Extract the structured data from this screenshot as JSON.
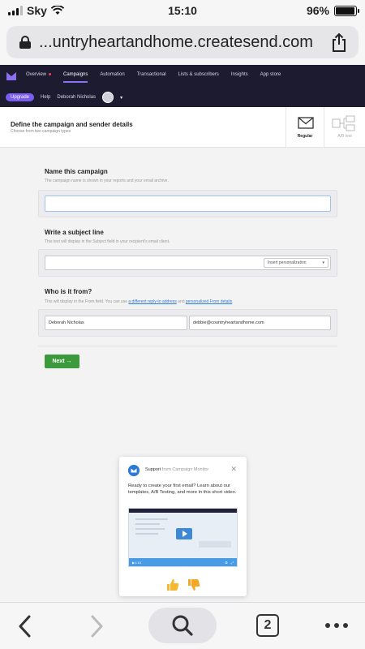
{
  "status_bar": {
    "carrier": "Sky",
    "time": "15:10",
    "battery": "96%",
    "battery_level": 0.96
  },
  "browser": {
    "url": "...untryheartandhome.createsend.com",
    "tab_count": "2"
  },
  "app_nav": {
    "items": [
      "Overview",
      "Campaigns",
      "Automation",
      "Transactional",
      "Lists & subscribers",
      "Insights",
      "App store"
    ],
    "active": "Campaigns",
    "upgrade_label": "Upgrade",
    "help_label": "Help",
    "user_name": "Deborah Nicholas"
  },
  "page": {
    "title": "Define the campaign and sender details",
    "subtitle": "Choose from two campaign types",
    "type_regular": "Regular",
    "type_ab": "A/B test"
  },
  "form": {
    "name_title": "Name this campaign",
    "name_help": "The campaign name is shown in your reports and your email archive.",
    "name_value": "",
    "subject_title": "Write a subject line",
    "subject_help": "This text will display in the Subject field in your recipient's email client.",
    "subject_value": "",
    "personalization_label": "Insert personalization",
    "from_title": "Who is it from?",
    "from_help_prefix": "This will display in the From field. You can use ",
    "from_help_link1": "a different reply-to address",
    "from_help_mid": " and ",
    "from_help_link2": "personalized From details",
    "from_help_suffix": ".",
    "from_name": "Deborah Nicholas",
    "from_email": "debbie@countryheartandhome.com",
    "next_label": "Next →"
  },
  "support_popup": {
    "head_strong": "Support",
    "head_light": " from Campaign Monitor",
    "body": "Ready to create your first email? Learn about our templates, A/B Testing, and more in this short video.",
    "video_time": "1:10"
  },
  "colors": {
    "nav_bg": "#1d1b2f",
    "accent": "#7a5cf0",
    "next_green": "#3c9a3c",
    "link_blue": "#2b7bd6"
  }
}
